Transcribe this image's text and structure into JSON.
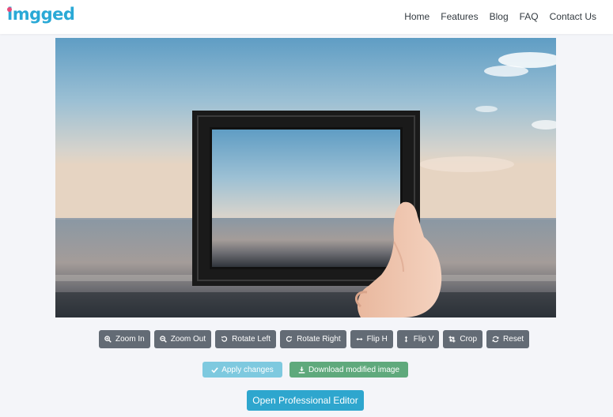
{
  "brand": {
    "name": "imgged",
    "color": "#2aa9d6",
    "dot_color": "#e84b7a"
  },
  "nav": {
    "items": [
      {
        "label": "Home"
      },
      {
        "label": "Features"
      },
      {
        "label": "Blog"
      },
      {
        "label": "FAQ"
      },
      {
        "label": "Contact Us"
      }
    ]
  },
  "image": {
    "subject": "hand-holding-picture-frame-over-sea"
  },
  "toolbar": {
    "color": "#636b75",
    "buttons": [
      {
        "label": "Zoom In",
        "icon": "zoom-in-icon"
      },
      {
        "label": "Zoom Out",
        "icon": "zoom-out-icon"
      },
      {
        "label": "Rotate Left",
        "icon": "rotate-left-icon"
      },
      {
        "label": "Rotate Right",
        "icon": "rotate-right-icon"
      },
      {
        "label": "Flip H",
        "icon": "flip-horizontal-icon"
      },
      {
        "label": "Flip V",
        "icon": "flip-vertical-icon"
      },
      {
        "label": "Crop",
        "icon": "crop-icon"
      },
      {
        "label": "Reset",
        "icon": "reset-icon"
      }
    ]
  },
  "actions": {
    "apply_label": "Apply changes",
    "apply_icon": "check-icon",
    "apply_color": "#7ec9df",
    "download_label": "Download modified image",
    "download_icon": "download-icon",
    "download_color": "#5fa97c"
  },
  "editor": {
    "label": "Open Professional Editor",
    "color": "#2ea6ce"
  }
}
